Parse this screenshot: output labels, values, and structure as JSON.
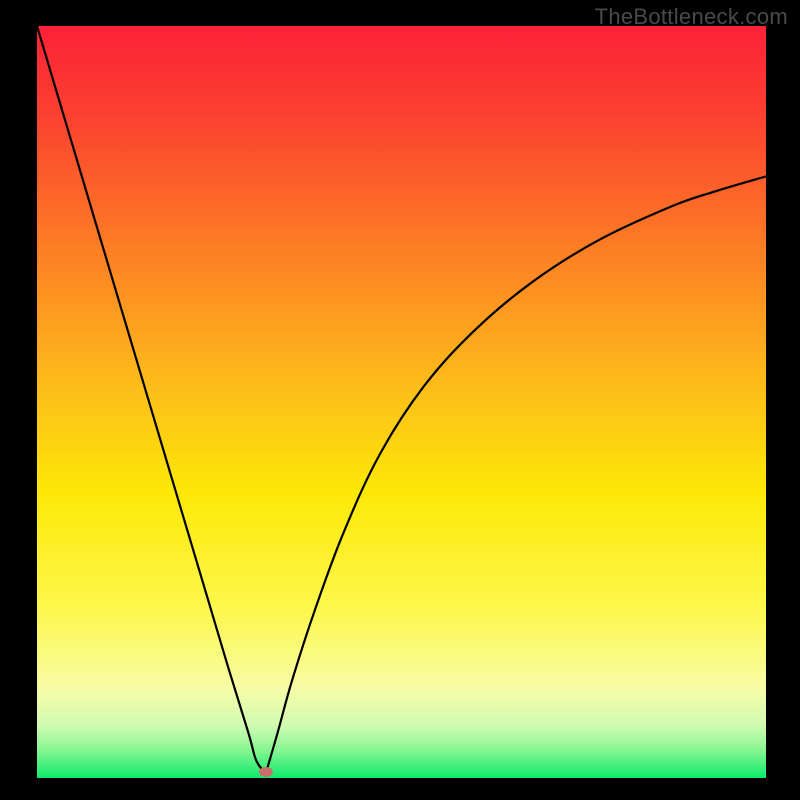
{
  "watermark": "TheBottleneck.com",
  "chart_data": {
    "type": "line",
    "description": "Bottleneck percentage curve over a gradient background (red = high bottleneck, green = low). A V-shaped black curve with its minimum near x≈0.31 of the horizontal axis; a small red marker highlights the minimum point.",
    "xlabel": "",
    "ylabel": "",
    "xlim": [
      0,
      1
    ],
    "ylim": [
      0,
      1
    ],
    "background_gradient": {
      "top": "#fc2138",
      "upper_mid": "#fdbd1a",
      "mid": "#fde806",
      "lower_mid": "#f8fca6",
      "bottom": "#0ceb6b"
    },
    "series": [
      {
        "name": "left-branch",
        "x": [
          0.0,
          0.0375,
          0.075,
          0.1125,
          0.15,
          0.1875,
          0.225,
          0.2625,
          0.29,
          0.3,
          0.31
        ],
        "y": [
          1.0,
          0.878,
          0.7561,
          0.6341,
          0.5122,
          0.3902,
          0.2683,
          0.1463,
          0.06,
          0.025,
          0.01
        ]
      },
      {
        "name": "right-branch",
        "x": [
          0.315,
          0.33,
          0.35,
          0.38,
          0.42,
          0.47,
          0.53,
          0.6,
          0.68,
          0.77,
          0.87,
          0.93,
          1.0
        ],
        "y": [
          0.01,
          0.06,
          0.13,
          0.22,
          0.325,
          0.43,
          0.52,
          0.595,
          0.66,
          0.715,
          0.76,
          0.78,
          0.8
        ]
      }
    ],
    "marker": {
      "x": 0.314,
      "y": 0.008,
      "color": "#c9706c"
    }
  }
}
